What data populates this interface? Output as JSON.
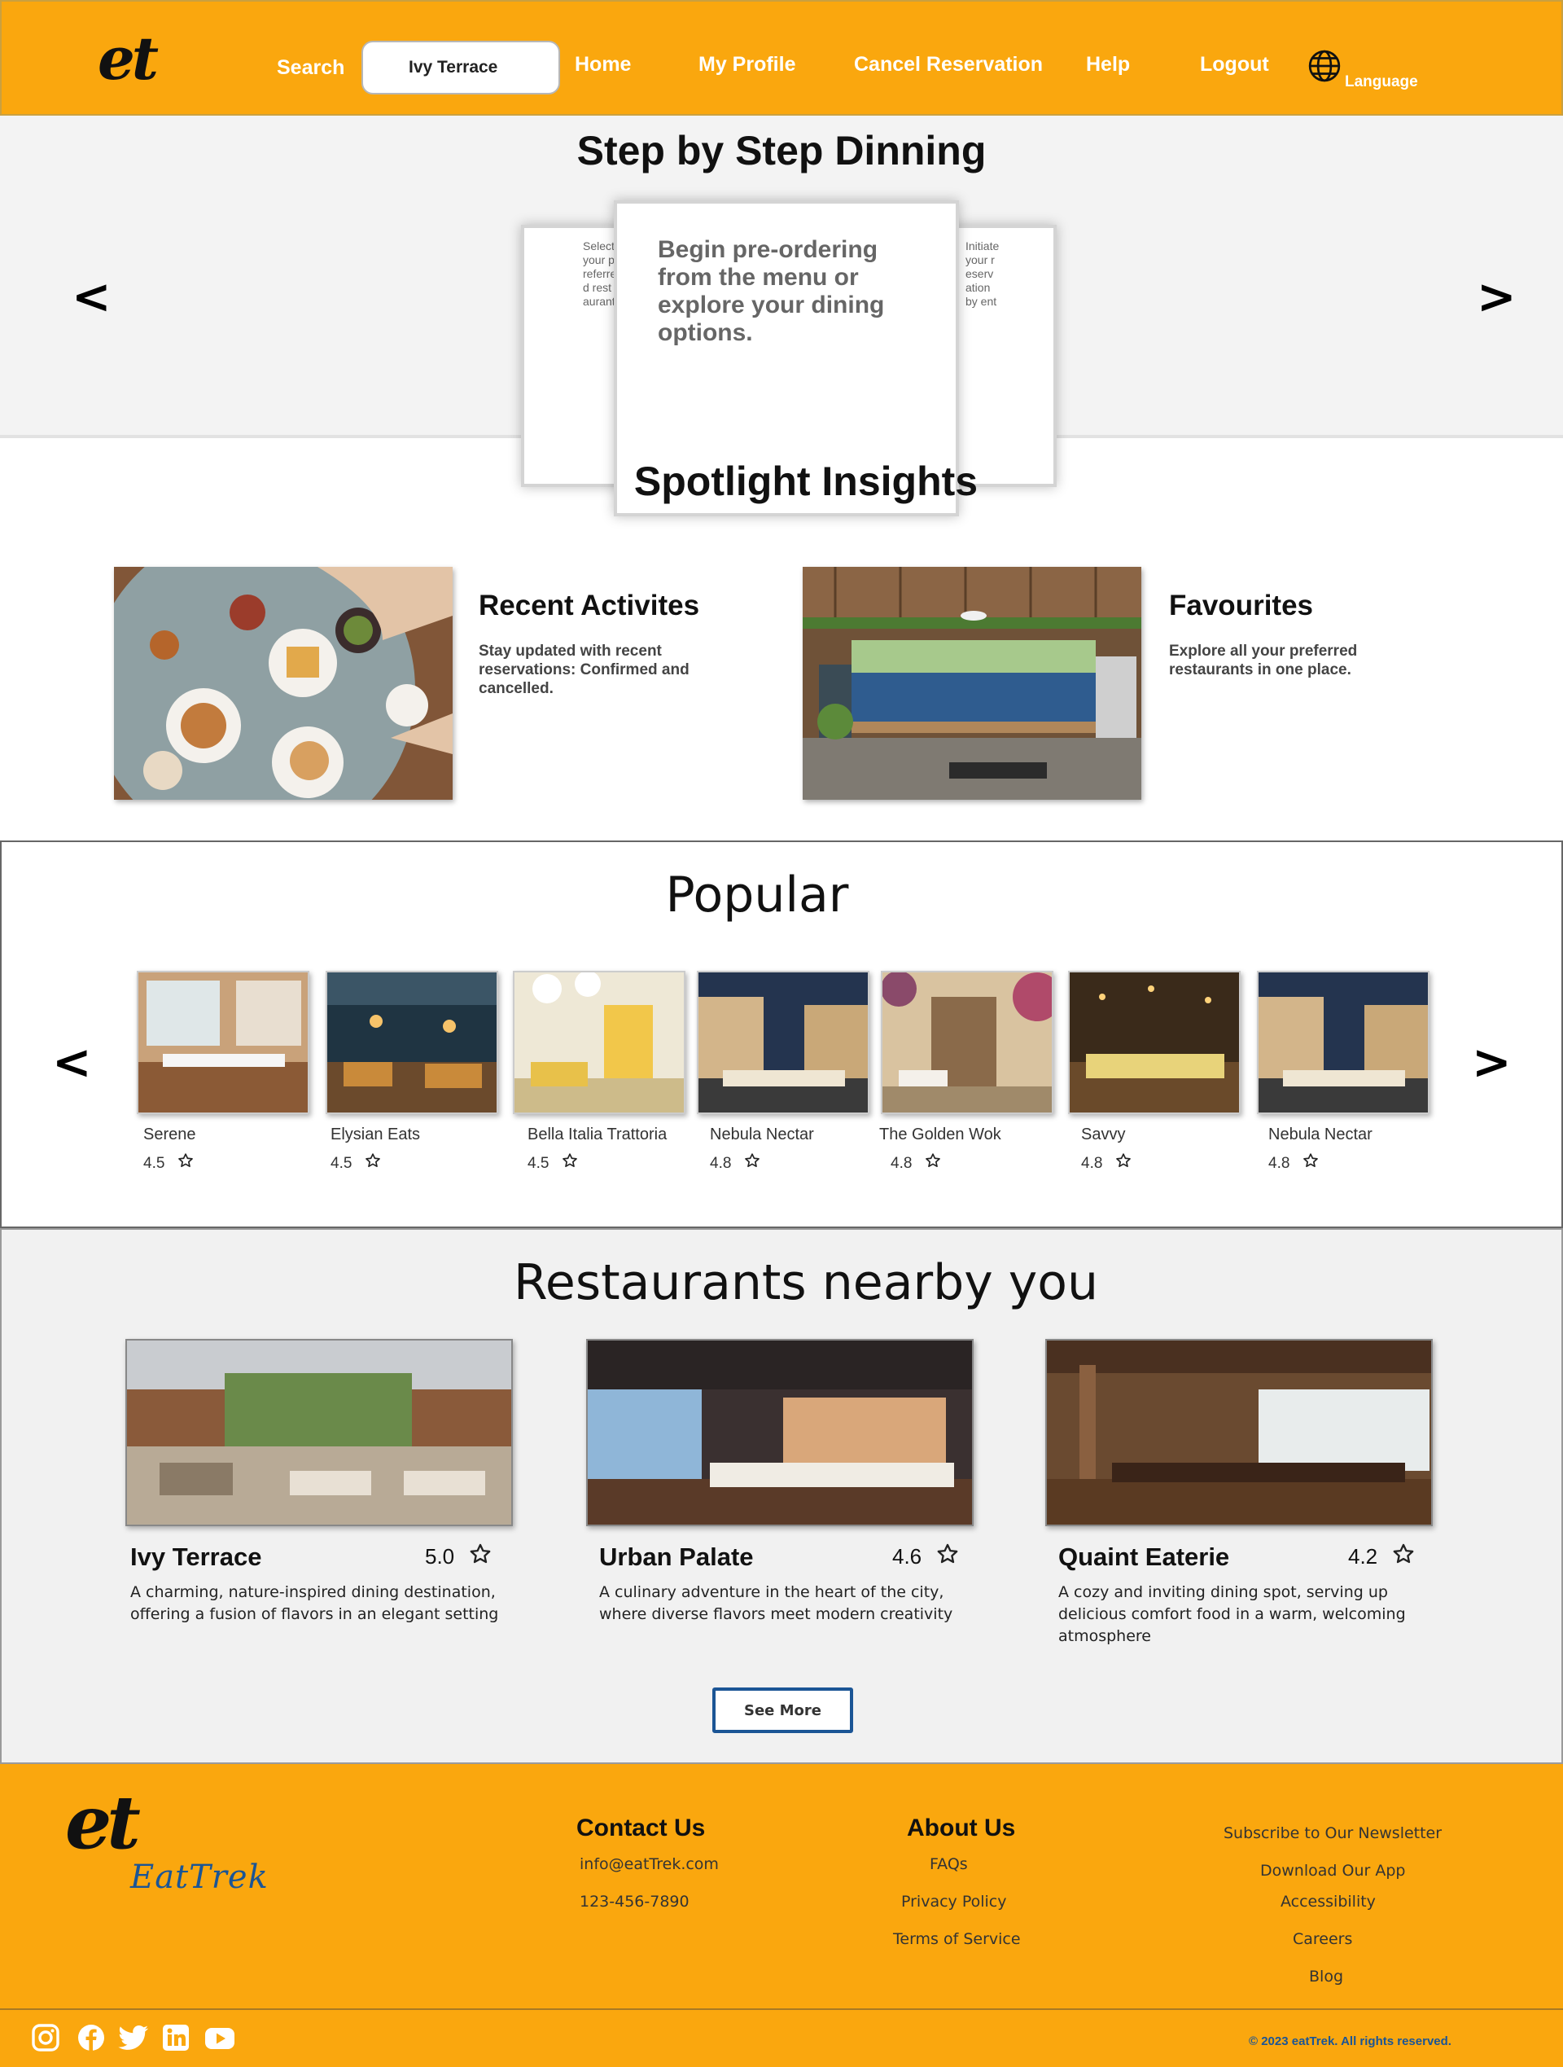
{
  "header": {
    "logo": "et",
    "search_label": "Search",
    "search_value": "Ivy Terrace",
    "nav": [
      "Home",
      "My Profile",
      "Cancel Reservation",
      "Help",
      "Logout"
    ],
    "language_label": "Language"
  },
  "steps": {
    "title": "Step by Step Dinning",
    "prev": "<",
    "next": ">",
    "left_card_text": "Select your preferred restaurant",
    "center_card_text": "Begin pre-ordering from the menu or explore your dining options.",
    "right_card_text": "Initiate your reservation by ent"
  },
  "spotlight": {
    "title": "Spotlight Insights",
    "cards": [
      {
        "title": "Recent Activites",
        "desc": "Stay updated with recent reservations: Confirmed and cancelled."
      },
      {
        "title": "Favourites",
        "desc": " Explore all your preferred restaurants in one place."
      }
    ]
  },
  "popular": {
    "title": "Popular",
    "prev": "<",
    "next": ">",
    "items": [
      {
        "name": "Serene",
        "rating": "4.5"
      },
      {
        "name": "Elysian Eats",
        "rating": "4.5"
      },
      {
        "name": "Bella Italia Trattoria",
        "rating": "4.5"
      },
      {
        "name": "Nebula Nectar",
        "rating": "4.8"
      },
      {
        "name": "The Golden Wok",
        "rating": "4.8"
      },
      {
        "name": "Savvy",
        "rating": "4.8"
      },
      {
        "name": "Nebula Nectar",
        "rating": "4.8"
      }
    ]
  },
  "nearby": {
    "title": "Restaurants nearby you",
    "items": [
      {
        "name": "Ivy Terrace",
        "rating": "5.0",
        "desc": " A charming, nature-inspired dining destination, offering a fusion of flavors in an elegant setting"
      },
      {
        "name": "Urban Palate",
        "rating": "4.6",
        "desc": "A culinary adventure in the heart of the city, where diverse flavors meet modern creativity"
      },
      {
        "name": "Quaint Eaterie",
        "rating": "4.2",
        "desc": "A cozy and inviting dining spot, serving up delicious comfort food in a warm, welcoming atmosphere"
      }
    ],
    "see_more": "See More"
  },
  "footer": {
    "logo": "et",
    "brand": "EatTrek",
    "contact": {
      "title": "Contact Us",
      "email": "info@eatTrek.com",
      "phone": "123-456-7890"
    },
    "about": {
      "title": "About Us",
      "links": [
        "FAQs",
        "Privacy Policy",
        "Terms of Service"
      ]
    },
    "right_links": [
      "Subscribe to Our Newsletter",
      "Download Our App",
      "Accessibility",
      "Careers",
      "Blog"
    ],
    "social": [
      "instagram-icon",
      "facebook-icon",
      "twitter-icon",
      "linkedin-icon",
      "youtube-icon"
    ],
    "copyright": "© 2023 eatTrek. All rights reserved."
  },
  "colors": {
    "brand": "#FAA70E",
    "accent_blue": "#1B5595",
    "section_grey": "#F1F1F1"
  }
}
